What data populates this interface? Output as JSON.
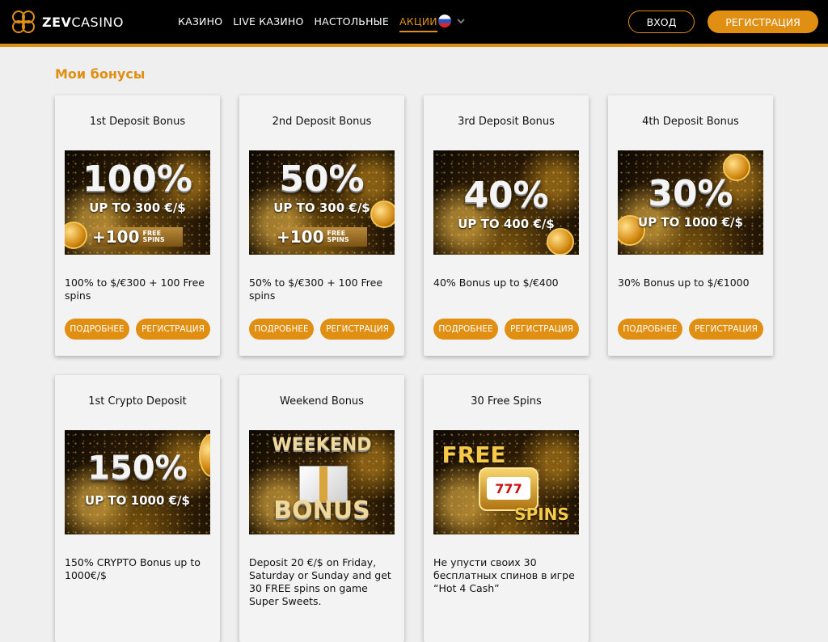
{
  "header": {
    "logo": {
      "text_bold": "ZEV",
      "text_thin": "CASINO",
      "icon": "clover-logo-icon"
    },
    "nav": [
      {
        "label": "КАЗИНО",
        "active": false
      },
      {
        "label": "LIVE КАЗИНО",
        "active": false
      },
      {
        "label": "НАСТОЛЬНЫЕ",
        "active": false
      },
      {
        "label": "АКЦИИ",
        "active": true
      }
    ],
    "language": {
      "flag": "russian-flag-icon",
      "chevron": "chevron-down-icon"
    },
    "login_label": "ВХОД",
    "register_label": "РЕГИСТРАЦИЯ",
    "accent_color": "#e08f13"
  },
  "page": {
    "title": "Мои бонусы"
  },
  "cards": [
    {
      "title": "1st Deposit Bonus",
      "art": {
        "big": "100%",
        "sub": "UP TO 300 €/$",
        "extra_num": "+100",
        "extra_text": "FREE SPINS"
      },
      "description": "100% to $/€300 + 100 Free spins",
      "more_label": "ПОДРОБНЕЕ",
      "register_label": "РЕГИСТРАЦИЯ"
    },
    {
      "title": "2nd Deposit Bonus",
      "art": {
        "big": "50%",
        "sub": "UP TO 300 €/$",
        "extra_num": "+100",
        "extra_text": "FREE SPINS"
      },
      "description": "50% to $/€300 + 100 Free spins",
      "more_label": "ПОДРОБНЕЕ",
      "register_label": "РЕГИСТРАЦИЯ"
    },
    {
      "title": "3rd Deposit Bonus",
      "art": {
        "big": "40%",
        "sub": "UP TO 400 €/$"
      },
      "description": "40% Bonus up to $/€400",
      "more_label": "ПОДРОБНЕЕ",
      "register_label": "РЕГИСТРАЦИЯ"
    },
    {
      "title": "4th Deposit Bonus",
      "art": {
        "big": "30%",
        "sub": "UP TO 1000 €/$"
      },
      "description": "30% Bonus up to $/€1000",
      "more_label": "ПОДРОБНЕЕ",
      "register_label": "РЕГИСТРАЦИЯ"
    },
    {
      "title": "1st Crypto Deposit",
      "art": {
        "big": "150%",
        "sub": "UP TO 1000 €/$"
      },
      "description": "150% CRYPTO Bonus up to 1000€/$"
    },
    {
      "title": "Weekend Bonus",
      "art": {
        "line1": "WEEKEND",
        "line2": "BONUS"
      },
      "description": "Deposit 20 €/$ on Friday, Saturday or Sunday and get 30 FREE spins on game Super Sweets."
    },
    {
      "title": "30 Free Spins",
      "art": {
        "line1": "FREE",
        "line2": "SPINS",
        "reels": "777"
      },
      "description": "Не упусти своих 30 бесплатных спинов в игре “Hot 4 Cash”"
    }
  ]
}
